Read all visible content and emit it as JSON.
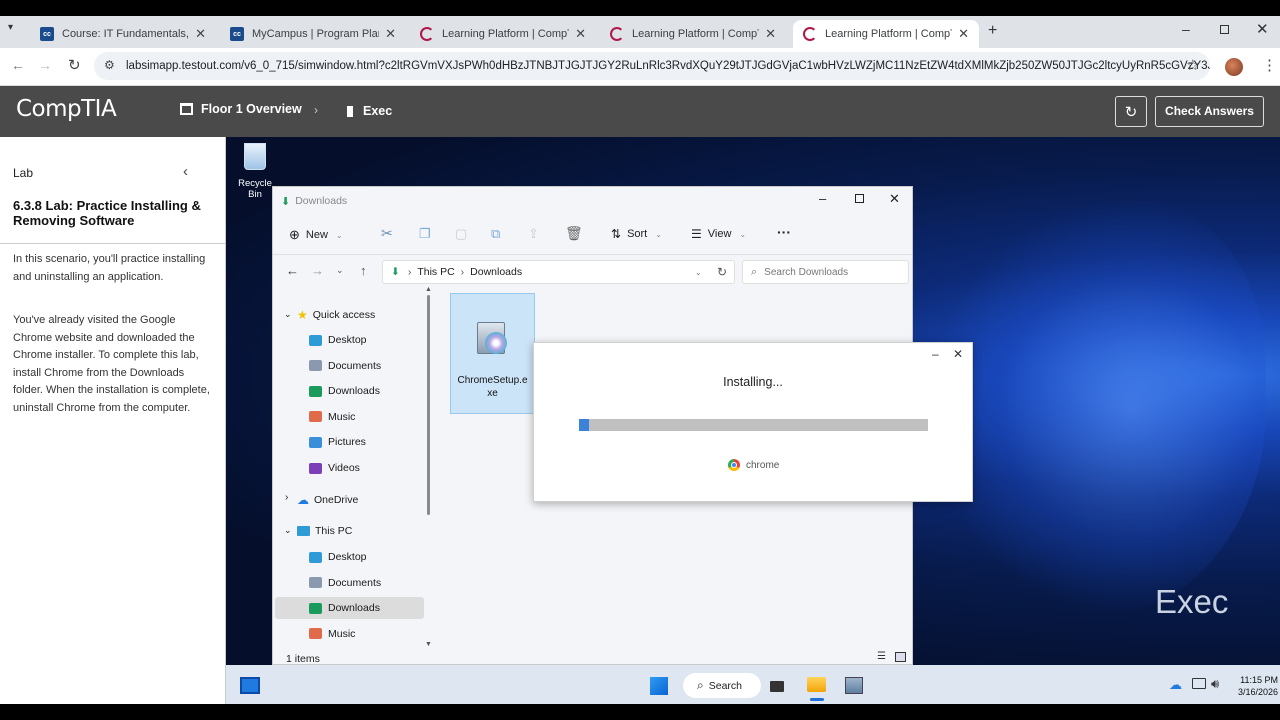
{
  "browser": {
    "tabs": [
      {
        "title": "Course: IT Fundamentals, :",
        "icon": "cc"
      },
      {
        "title": "MyCampus | Program Plan",
        "icon": "cc"
      },
      {
        "title": "Learning Platform | CompTIA",
        "icon": "lp"
      },
      {
        "title": "Learning Platform | CompTIA",
        "icon": "lp"
      },
      {
        "title": "Learning Platform | CompTIA",
        "icon": "lp"
      }
    ],
    "active_tab": 4,
    "url": "labsimapp.testout.com/v6_0_715/simwindow.html?c2ltRGVmVXJsPWh0dHBzJTNBJTJGJTJGY2RuLnRlc3RvdXQuY29tJTJGdGVjaC1wbHVzLWZjMC11NzEtZW4tdXMlMkZjb250ZW50JTJGc2ltcyUyRnR5cGVzY3JpcHR2M..."
  },
  "header": {
    "logo": "CompTIA",
    "crumb1": "Floor 1 Overview",
    "crumb2": "Exec",
    "check_answers": "Check Answers"
  },
  "lab": {
    "section": "Lab",
    "title": "6.3.8 Lab: Practice Installing & Removing Software",
    "para1": "In this scenario, you'll practice installing and uninstalling an application.",
    "para2": "You've already visited the Google Chrome website and downloaded the Chrome installer. To complete this lab, install Chrome from the Downloads folder. When the installation is complete, uninstall Chrome from the computer."
  },
  "desktop": {
    "recycle_bin": "Recycle Bin",
    "watermark": "Exec"
  },
  "explorer": {
    "title": "Downloads",
    "toolbar": {
      "new": "New",
      "sort": "Sort",
      "view": "View",
      "more": "···"
    },
    "breadcrumb": [
      "This PC",
      "Downloads"
    ],
    "search_placeholder": "Search Downloads",
    "nav": {
      "quick_access": "Quick access",
      "qa_items": [
        {
          "label": "Desktop",
          "color": "#2e9bd6"
        },
        {
          "label": "Documents",
          "color": "#8a99ad"
        },
        {
          "label": "Downloads",
          "color": "#1a9b5b"
        },
        {
          "label": "Music",
          "color": "#e06b4a"
        },
        {
          "label": "Pictures",
          "color": "#3a8fd8"
        },
        {
          "label": "Videos",
          "color": "#7b3fb8"
        }
      ],
      "onedrive": "OneDrive",
      "this_pc": "This PC",
      "pc_items": [
        {
          "label": "Desktop",
          "color": "#2e9bd6"
        },
        {
          "label": "Documents",
          "color": "#8a99ad"
        },
        {
          "label": "Downloads",
          "color": "#1a9b5b"
        },
        {
          "label": "Music",
          "color": "#e06b4a"
        }
      ],
      "selected": "Downloads"
    },
    "file": {
      "name": "ChromeSetup.exe",
      "line1": "ChromeSetup.e",
      "line2": "xe"
    },
    "status": "1 items"
  },
  "installer": {
    "status": "Installing...",
    "progress": 0.03,
    "brand": "chrome"
  },
  "taskbar": {
    "search": "Search",
    "time": "11:15 PM",
    "date": "3/16/2026"
  }
}
